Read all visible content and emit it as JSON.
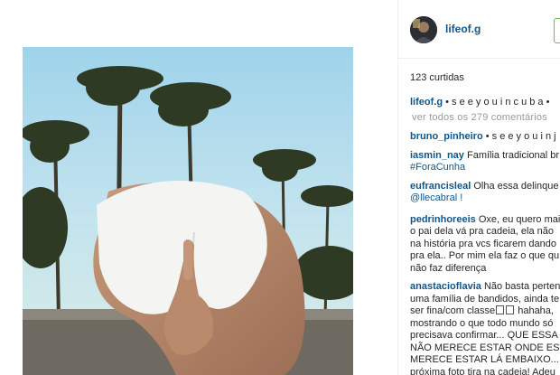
{
  "post": {
    "username": "lifeof.g",
    "likes": "123 curtidas",
    "caption_user": "lifeof.g",
    "caption_text": "• s e e y o u i n c u b a •",
    "view_all": "ver todos os 279 comentários"
  },
  "comments": [
    {
      "user": "bruno_pinheiro",
      "lines": [
        "• s e e y o u i n j"
      ]
    },
    {
      "user": "iasmin_nay",
      "lines": [
        "Família tradicional br",
        "#ForaCunha"
      ]
    },
    {
      "user": "eufrancisleal",
      "lines": [
        "Olha essa delinque",
        "@llecabral !"
      ]
    },
    {
      "user": "pedrinhoreeis",
      "lines": [
        "Oxe, eu quero mai",
        "o pai dela vá pra cadeia, ela não",
        "na história pra vcs ficarem dando",
        "pra ela.. Por mim ela faz o que qu",
        "não faz diferença"
      ]
    },
    {
      "user": "anastacioflavia",
      "lines": [
        "Não basta perten",
        "uma família de bandidos, ainda te",
        "ser fina/com classe",
        "mostrando o que todo mundo só",
        "precisava confirmar... QUE ESSA F",
        "NÃO MERECE ESTAR ONDE EST",
        "MERECE ESTAR LÁ EMBAIXO... F",
        "próxima foto tira na cadeia! Adeu"
      ]
    }
  ],
  "ana_extra": {
    "after_boxes": " hahaha,"
  },
  "colors": {
    "link": "#125688",
    "text": "#262626",
    "muted": "#999999",
    "follow": "#70c050"
  },
  "icons": [
    "avatar-photo",
    "emoji-box-icon"
  ]
}
